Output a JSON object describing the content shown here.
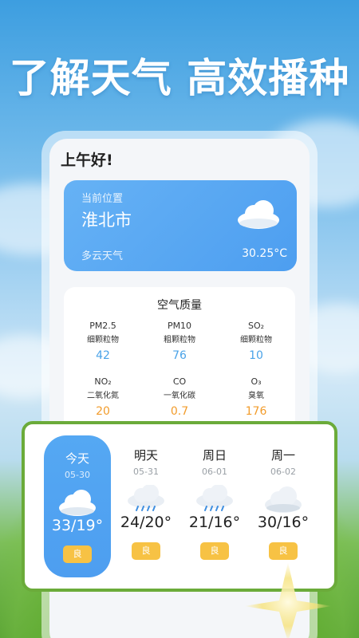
{
  "headline": "了解天气 高效播种",
  "greeting": "上午好!",
  "location_card": {
    "label": "当前位置",
    "city": "淮北市",
    "condition": "多云天气",
    "temperature": "30.25°C"
  },
  "air_quality": {
    "title": "空气质量",
    "items": [
      {
        "name": "PM2.5",
        "desc": "细颗粒物",
        "value": "42",
        "color": "#4aa3e8"
      },
      {
        "name": "PM10",
        "desc": "粗颗粒物",
        "value": "76",
        "color": "#4aa3e8"
      },
      {
        "name": "SO₂",
        "desc": "细颗粒物",
        "value": "10",
        "color": "#4aa3e8"
      },
      {
        "name": "NO₂",
        "desc": "二氧化氮",
        "value": "20",
        "color": "#f29c2c"
      },
      {
        "name": "CO",
        "desc": "一氧化碳",
        "value": "0.7",
        "color": "#f29c2c"
      },
      {
        "name": "O₃",
        "desc": "臭氧",
        "value": "176",
        "color": "#f29c2c"
      }
    ]
  },
  "forecast": [
    {
      "day": "今天",
      "date": "05-30",
      "temp": "33/19°",
      "quality": "良",
      "icon": "cloud-icon",
      "active": true
    },
    {
      "day": "明天",
      "date": "05-31",
      "temp": "24/20°",
      "quality": "良",
      "icon": "rain-cloud-icon",
      "active": false
    },
    {
      "day": "周日",
      "date": "06-01",
      "temp": "21/16°",
      "quality": "良",
      "icon": "rain-cloud-icon",
      "active": false
    },
    {
      "day": "周一",
      "date": "06-02",
      "temp": "30/16°",
      "quality": "良",
      "icon": "cloud-icon",
      "active": false
    }
  ],
  "colors": {
    "accent": "#4d9ef0",
    "badge": "#f7c244",
    "frame_green": "#6bab3a"
  }
}
